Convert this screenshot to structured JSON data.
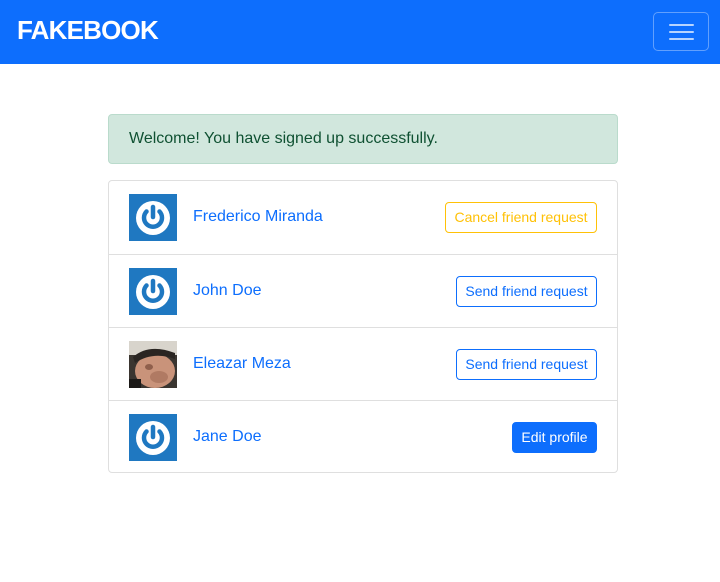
{
  "app": {
    "brand": "FAKEBOOK",
    "brand_color": "#0d6efd",
    "menu_icon": "hamburger-menu-icon"
  },
  "alert": {
    "message": "Welcome! You have signed up successfully.",
    "type": "success"
  },
  "users": [
    {
      "name": "Frederico Miranda",
      "avatar": "default-power-avatar",
      "action": "Cancel friend request",
      "action_style": "warning-outline"
    },
    {
      "name": "John Doe",
      "avatar": "default-power-avatar",
      "action": "Send friend request",
      "action_style": "primary-outline"
    },
    {
      "name": "Eleazar Meza",
      "avatar": "photo-avatar",
      "action": "Send friend request",
      "action_style": "primary-outline"
    },
    {
      "name": "Jane Doe",
      "avatar": "default-power-avatar",
      "action": "Edit profile",
      "action_style": "primary"
    }
  ]
}
